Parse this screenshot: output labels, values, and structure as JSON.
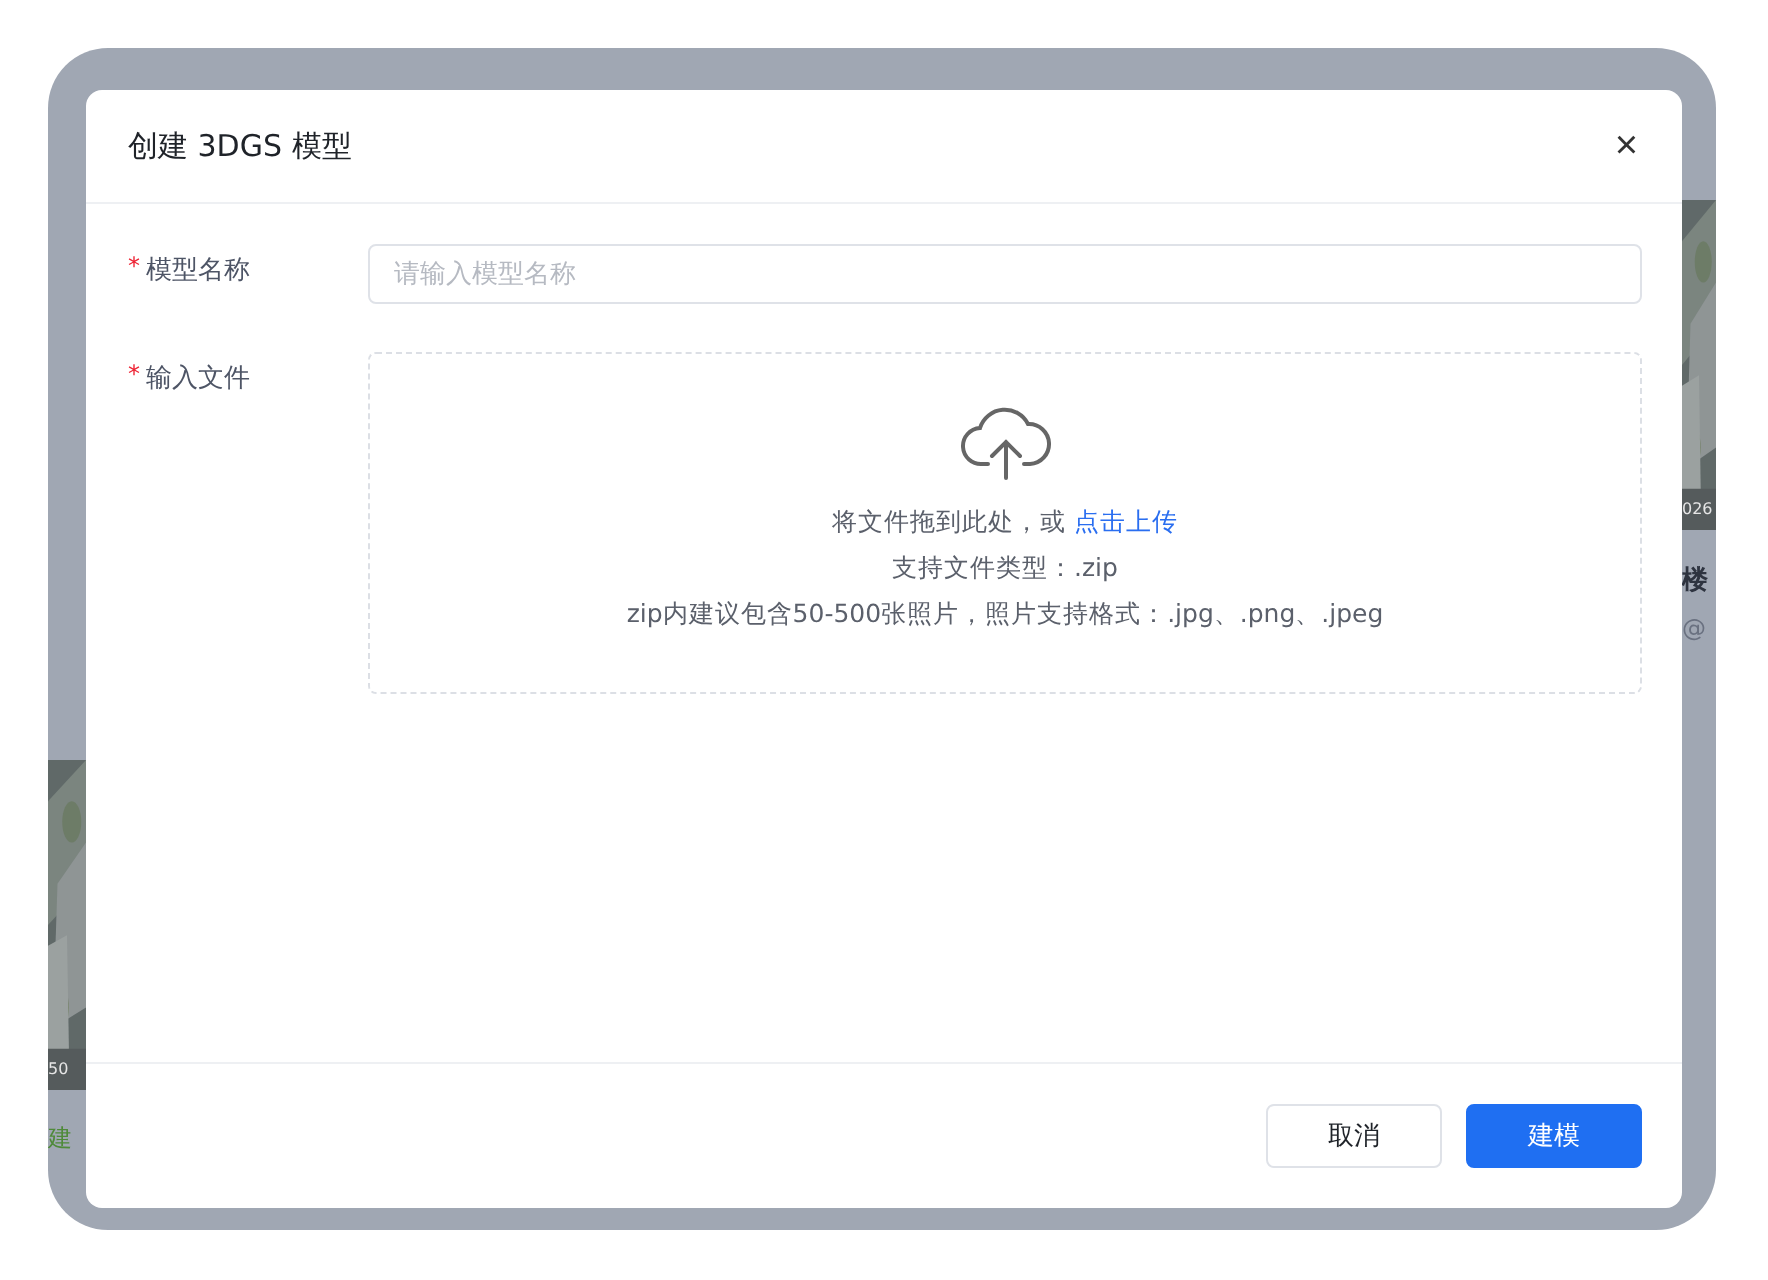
{
  "background": {
    "cards": [
      {
        "kind": "picture",
        "caption": "026",
        "title": "楼",
        "subtitle": "@"
      },
      {
        "kind": "picture",
        "caption": "50",
        "title": "建"
      }
    ]
  },
  "dialog": {
    "title": "创建 3DGS 模型",
    "close": "×",
    "fields": [
      {
        "kind": "text",
        "label": "模型名称",
        "required_mark": "*",
        "placeholder": "请输入模型名称"
      },
      {
        "kind": "upload",
        "label": "输入文件",
        "required_mark": "*",
        "prompt": "将文件拖到此处，或",
        "link": "点击上传",
        "hints": [
          "支持文件类型：.zip",
          "zip内建议包含50-500张照片，照片支持格式：.jpg、.png、.jpeg"
        ]
      }
    ],
    "buttons": [
      {
        "label": "取消",
        "kind": "secondary"
      },
      {
        "label": "建模",
        "kind": "primary"
      }
    ]
  }
}
